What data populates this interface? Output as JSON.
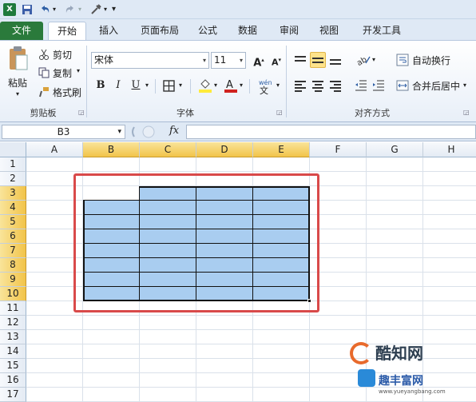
{
  "tabs": [
    "文件",
    "开始",
    "插入",
    "页面布局",
    "公式",
    "数据",
    "审阅",
    "视图",
    "开发工具"
  ],
  "clipboard": {
    "paste": "粘贴",
    "cut": "剪切",
    "copy": "复制",
    "format_painter": "格式刷",
    "label": "剪贴板"
  },
  "font": {
    "name": "宋体",
    "size": "11",
    "label": "字体",
    "bold": "B",
    "italic": "I",
    "underline": "U"
  },
  "alignment": {
    "wrap": "自动换行",
    "merge": "合并后居中",
    "label": "对齐方式"
  },
  "formula_bar": {
    "name_box": "B3",
    "fx": "fx"
  },
  "columns": [
    "A",
    "B",
    "C",
    "D",
    "E",
    "F",
    "G",
    "H"
  ],
  "rows": [
    "1",
    "2",
    "3",
    "4",
    "5",
    "6",
    "7",
    "8",
    "9",
    "10",
    "11",
    "12",
    "13",
    "14",
    "15",
    "16",
    "17"
  ],
  "selection": {
    "col_start": 1,
    "col_end": 4,
    "row_start": 2,
    "row_end": 9
  },
  "watermark": {
    "brand": "酷知网",
    "sub": "趣丰富网",
    "url": "www.yueyangbang.com"
  },
  "colors": {
    "selection_fill": "#a9cdf0",
    "header_selected": "#f2c44a",
    "highlight_box": "#d94a4a",
    "file_tab": "#2a7a3b"
  }
}
